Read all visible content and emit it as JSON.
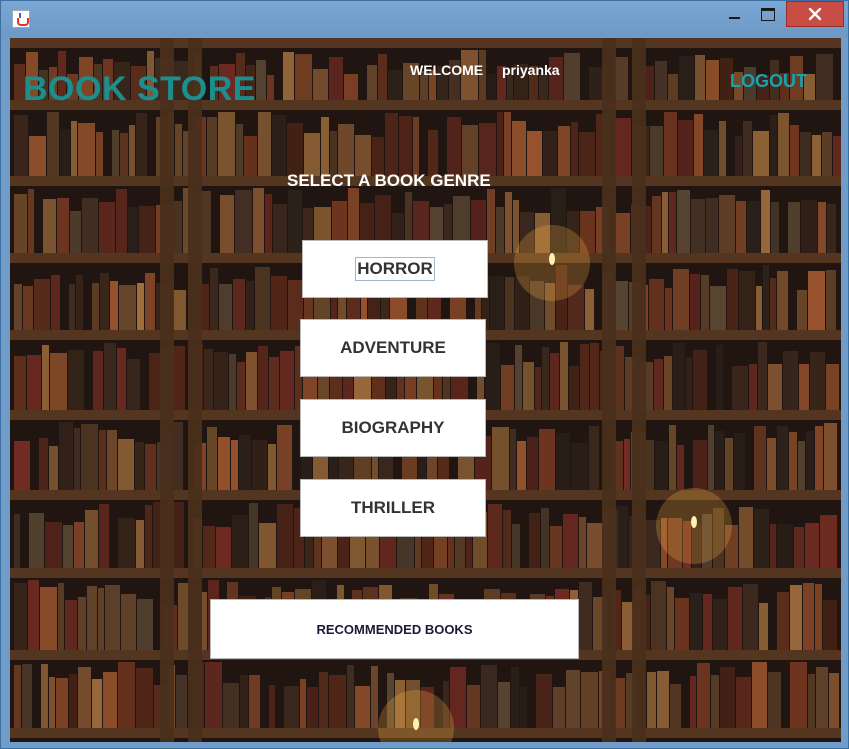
{
  "window": {
    "title": ""
  },
  "header": {
    "app_title": "BOOK STORE",
    "welcome_label": "WELCOME",
    "username": "priyanka",
    "logout_label": "LOGOUT"
  },
  "main": {
    "genre_prompt": "SELECT A BOOK GENRE",
    "genres": [
      "HORROR",
      "ADVENTURE",
      "BIOGRAPHY",
      "THRILLER"
    ],
    "recommended_label": "RECOMMENDED BOOKS"
  },
  "colors": {
    "title": "#1a8f8e",
    "logout": "#17a3b0",
    "close_button": "#c94c45",
    "background": "#231710"
  }
}
